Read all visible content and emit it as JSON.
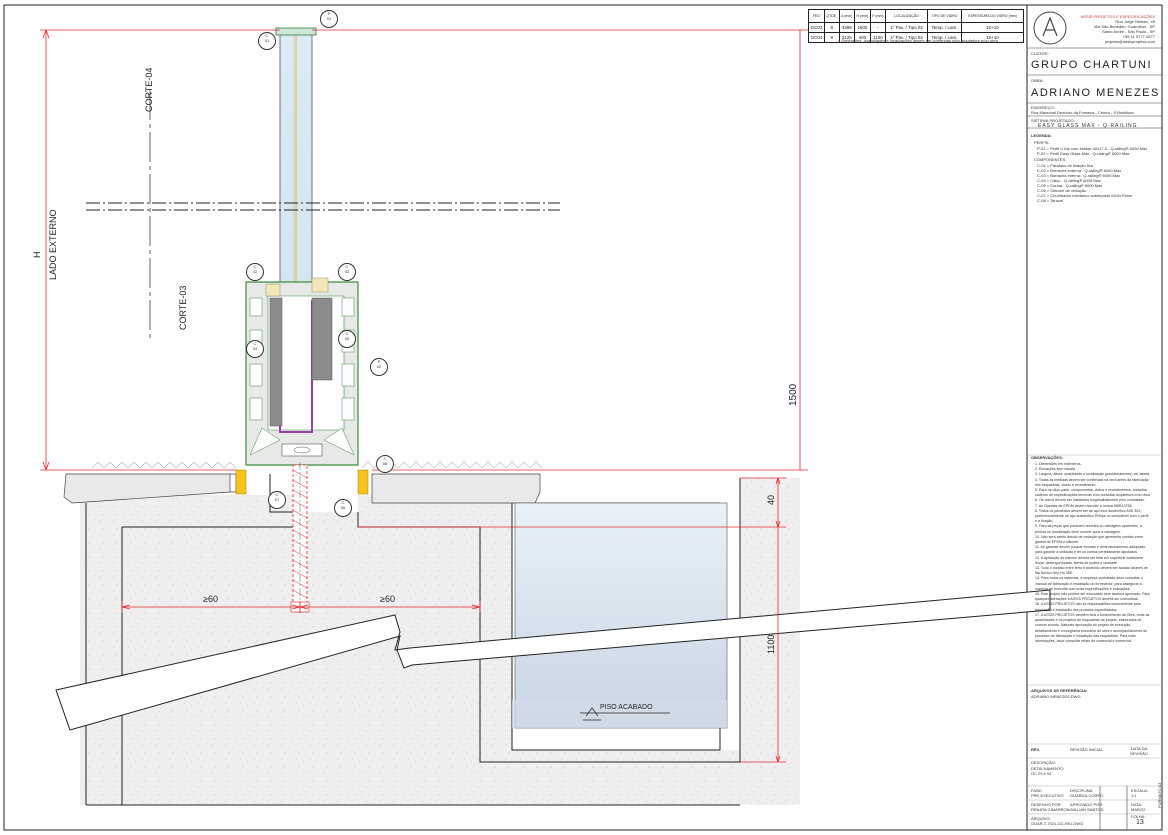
{
  "table": {
    "headers": [
      "FEO",
      "QTDE.",
      "A (mm)",
      "H (mm)",
      "F (mm)",
      "LOCALIZAÇÃO",
      "TIPO DE VIDRO",
      "ESPESSURA DO VIDRO (mm)"
    ],
    "rows": [
      [
        "GC03",
        "8",
        "3399",
        "1500",
        "-",
        "1º Pav. / Tipo 02",
        "Temp. / Lam.",
        "10+10"
      ],
      [
        "GC04",
        "8",
        "3125",
        "400",
        "1100",
        "1º Pav. / Tipo 02",
        "Temp. / Lam.",
        "10+10"
      ]
    ],
    "note": "Dimensões, quantidades e localizações devem ser conferidas pela arquitetura e/ou obra",
    "note_mark": "!!"
  },
  "company": {
    "name": "ASSIS PROJETOS E ESPECIFICAÇÕES",
    "address": [
      "Rua Jorge Nielsen, 45",
      "Vila São Benedito, Guarulhos - SP",
      "Santo André - São Paulo - SP",
      "+55 11 9777-5577",
      "projetos@assisprojetos.com"
    ]
  },
  "title_block": {
    "client_label": "CLIENTE:",
    "client": "GRUPO CHARTUNI",
    "work_label": "OBRA:",
    "work": "ADRIANO MENEZES",
    "address_label": "ENDEREÇO:",
    "address": "Rua Marechal Deodoro da Fonseca - Centro - S.Bonifácio",
    "system_label": "SISTEMA PROJETADO:",
    "system": "EASY GLASS MAX - Q-RAILING",
    "legend_label": "LEGENDA:",
    "profiles_label": "PERFIS:",
    "profiles": [
      "P-01 = Perfil U top com ênfase 42x17.5 - Q-railing® 6000 Max",
      "P-02 = Perfil Easy Glass Max - Q-railing® 6000 Max"
    ],
    "components_label": "COMPONENTES:",
    "components": [
      "C-01 = Parafuso de fixação fixa",
      "C-02 = Borracha externa - Q-railing® 6000 Max",
      "C-03 = Borracha interna - Q-railing® 6000 Max",
      "C-04 = Calço - Q-railing® 6000 Max",
      "C-05 = Cunha - Q-railing® 6000 Max",
      "C-06 = Silicone de vedação",
      "C-07 = Chumbador mecânico sobreposto M10x70mm",
      "C-08 = Tarucel"
    ],
    "obs_title": "OBSERVAÇÕES:",
    "obs": [
      "1. Dimensões em milímetros.",
      "2. Elevações sem escala.",
      "3. Largura, altura, quantidade e localização (posicionamento) ver tabela.",
      "4. Todas as medidas devem ser conferidas na obra antes da fabricação dos esquadrias, vidros e revestimento.",
      "5. Para os vãos parte, componentes, vidros e revestimentos, consultar caderno de especificações técnicas e/ou consultar arquitetura e/ou obra.",
      "6. Os vidros devem ser instalados longitudinalmente pelo contratado.",
      "7. As Gaxetas de EPDM devem atender a norma NBR13756.",
      "8. Todos os parafusos devem ser de aço inox austenítico AISI 304, preferencialmente de aço austenítico Philips ou compatível com o perfil e a fixação.",
      "9. Para as peças que possuem recortes ou usinagens aparentes, a pintura ou anodização deve ocorrer após a usinagem.",
      "10. Não será aceito desvio de vedação que apresente contato entre gaxeta de EPDM e silicone.",
      "11. As gaxetas devem possuir formato e dimensionamento adequado para garantir a vedação e ter os cantos perfeitamente ajustados.",
      "12. A aplicação do silicone deverá ser feita em superfície totalmente limpa, desengordurada, isenta de poeira e umidade.",
      "13. Todo o contato entre ferro e alumínio deverá ser isolado através de fita Norton Hey-Ho 35E.",
      "14. Para todos os sistemas, a empresa contratada deve consultar o manual de fabricação e instalação do fornecedor, para assegurar a maneira de executar com suas especificações e indicações.",
      "15. Este projeto não poderá ser executado sem sistema aprovado. Para qualquer alterações à ASSIS PROJETOS deverá ser consultada.",
      "16. A ASSIS PROJETOS não se responsabiliza tecnicamente pela fabricação e instalação dos produtos especificados.",
      "17. A ASSIS PROJETOS também fará o fornecimento da Obra, onde as quantidades e os projetos de esquadrias do projeto, elaborados de comum acordo. Naturais aprovação do projeto de execução, detalhamento e cronograma executivo de obra e acompanhamento do processo de fabricação e instalação das esquadrias. Para mais informações, favor consultar relato de comercial e comercial."
    ],
    "ref_label": "ARQUIVOS DE REFERÊNCIA:",
    "ref": "ADRIANO MENEZES.DWG",
    "rev_label": "REV.",
    "rev_desc": "REVISÃO INICIAL",
    "rev_date_label": "DATA DA REVISÃO",
    "drawing_label": "DESCRIÇÃO:",
    "drawing": "DETALHAMENTO",
    "drawing_sub": "GC 03 e 04",
    "phase_label": "FASE:",
    "phase": "PRÉ-EXECUTIVO",
    "discipline_label": "DISCIPLINA:",
    "discipline": "GUARDA-CORPO",
    "scale_label": "ESCALA:",
    "scale": "1:1",
    "designer_label": "DESENHO POR:",
    "designer": "RENATA GIMARRON",
    "approver_label": "APROVADO POR:",
    "approver": "WILLIAN SANTOS",
    "date_label": "DATA:",
    "date": "MAR/22",
    "file_label": "ARQUIVO:",
    "file": "GUAR-T-7021-GC-R01.DWG",
    "page_label": "FOLHA:",
    "page": "13",
    "format": "FORMATO A3"
  },
  "drawing": {
    "tags": {
      "p01": [
        "P",
        "01"
      ],
      "c01": [
        "C",
        "01"
      ],
      "c02": [
        "C",
        "02"
      ],
      "c03": [
        "C",
        "03"
      ],
      "c04": [
        "C",
        "04"
      ],
      "c05": [
        "C",
        "05"
      ],
      "p02": [
        "P",
        "02"
      ],
      "c06": [
        "C",
        "06"
      ],
      "c07": [
        "C",
        "07"
      ],
      "c08": [
        "C",
        "08"
      ]
    },
    "corte04": "CORTE-04",
    "corte03": "CORTE-03",
    "h_label": "H",
    "side_label": "LADO EXTERNO",
    "dim_1500": "1500",
    "dim_40": "40",
    "dim_1100": "1100",
    "dim_60_left": "≥60",
    "dim_60_right": "≥60",
    "floor_label": "PISO ACABADO"
  },
  "colors": {
    "frame": "#222222",
    "red_dim": "#e8262b",
    "glass": "#d4e6f1",
    "profile": "#e6e9e6",
    "profile_edge": "#3e8d3a",
    "purple": "#9a3fa7",
    "wedge": "#8c8c8c",
    "shim": "#f5c51e",
    "concrete": "#efefef"
  }
}
